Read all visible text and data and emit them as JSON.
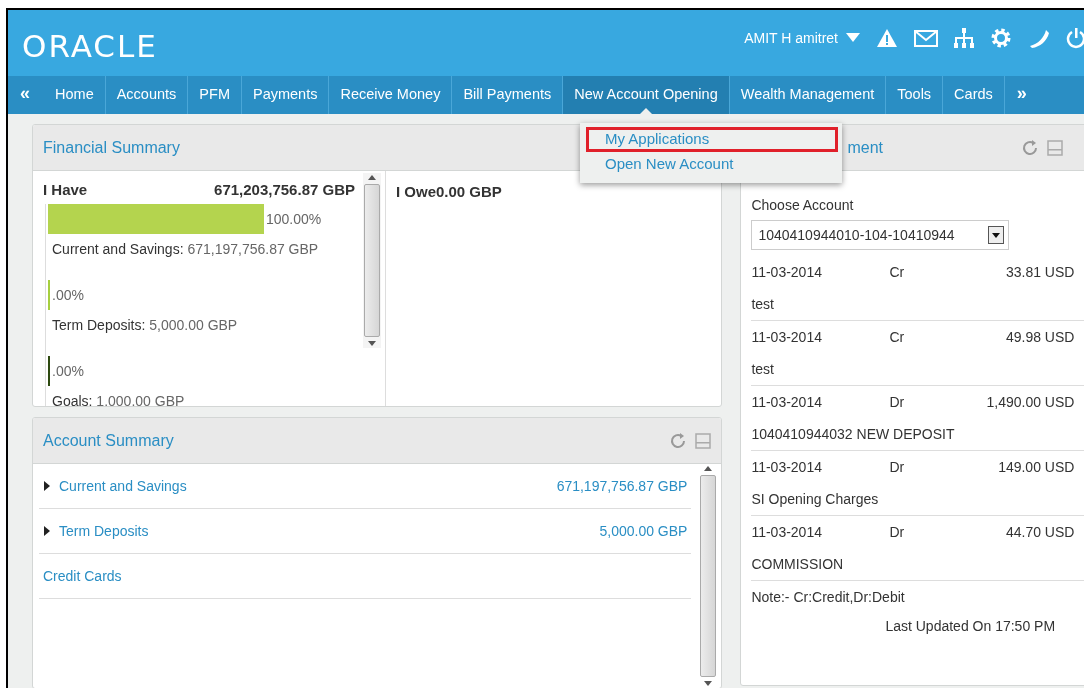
{
  "header": {
    "logo": "ORACLE",
    "user": "AMIT H amitret"
  },
  "nav": {
    "prev": "«",
    "next": "»",
    "items": [
      {
        "label": "Home",
        "selected": false
      },
      {
        "label": "Accounts",
        "selected": false
      },
      {
        "label": "PFM",
        "selected": false
      },
      {
        "label": "Payments",
        "selected": false
      },
      {
        "label": "Receive Money",
        "selected": false
      },
      {
        "label": "Bill Payments",
        "selected": false
      },
      {
        "label": "New Account Opening",
        "selected": true
      },
      {
        "label": "Wealth Management",
        "selected": false
      },
      {
        "label": "Tools",
        "selected": false
      },
      {
        "label": "Cards",
        "selected": false
      }
    ]
  },
  "dropdown": {
    "items": [
      {
        "label": "My Applications",
        "selected": true
      },
      {
        "label": "Open New Account",
        "selected": false
      }
    ]
  },
  "financial_summary": {
    "title": "Financial Summary",
    "have": {
      "label": "I Have",
      "total": "671,203,756.87 GBP",
      "items": [
        {
          "percent": "100.00%",
          "color": "#b4d44e",
          "label": "Current and Savings:",
          "amount": "671,197,756.87 GBP"
        },
        {
          "percent": ".00%",
          "color": "#a6cf3e",
          "label": "Term Deposits:",
          "amount": "5,000.00 GBP"
        },
        {
          "percent": ".00%",
          "color": "#2e4a10",
          "label": "Goals:",
          "amount": "1,000.00 GBP"
        }
      ]
    },
    "owe": {
      "label": "I Owe",
      "total": "0.00 GBP"
    }
  },
  "account_summary": {
    "title": "Account Summary",
    "rows": [
      {
        "kind": "group",
        "expanded": false,
        "label": "Current and Savings",
        "amount": "671,197,756.87 GBP"
      },
      {
        "kind": "group",
        "expanded": false,
        "label": "Term Deposits",
        "amount": "5,000.00 GBP"
      },
      {
        "kind": "link",
        "label": "Credit Cards"
      }
    ]
  },
  "mini_statement": {
    "title": "ment",
    "choose_label": "Choose Account",
    "account": "1040410944010-104-10410944",
    "rows": [
      {
        "date": "11-03-2014",
        "type": "Cr",
        "amount": "33.81 USD",
        "description": "test"
      },
      {
        "date": "11-03-2014",
        "type": "Cr",
        "amount": "49.98 USD",
        "description": "test"
      },
      {
        "date": "11-03-2014",
        "type": "Dr",
        "amount": "1,490.00 USD",
        "description": "1040410944032 NEW DEPOSIT"
      },
      {
        "date": "11-03-2014",
        "type": "Dr",
        "amount": "149.00 USD",
        "description": "SI Opening Charges"
      },
      {
        "date": "11-03-2014",
        "type": "Dr",
        "amount": "44.70 USD",
        "description": "COMMISSION"
      }
    ],
    "note": "Note:- Cr:Credit,Dr:Debit",
    "updated": "Last Updated On 17:50 PM"
  }
}
